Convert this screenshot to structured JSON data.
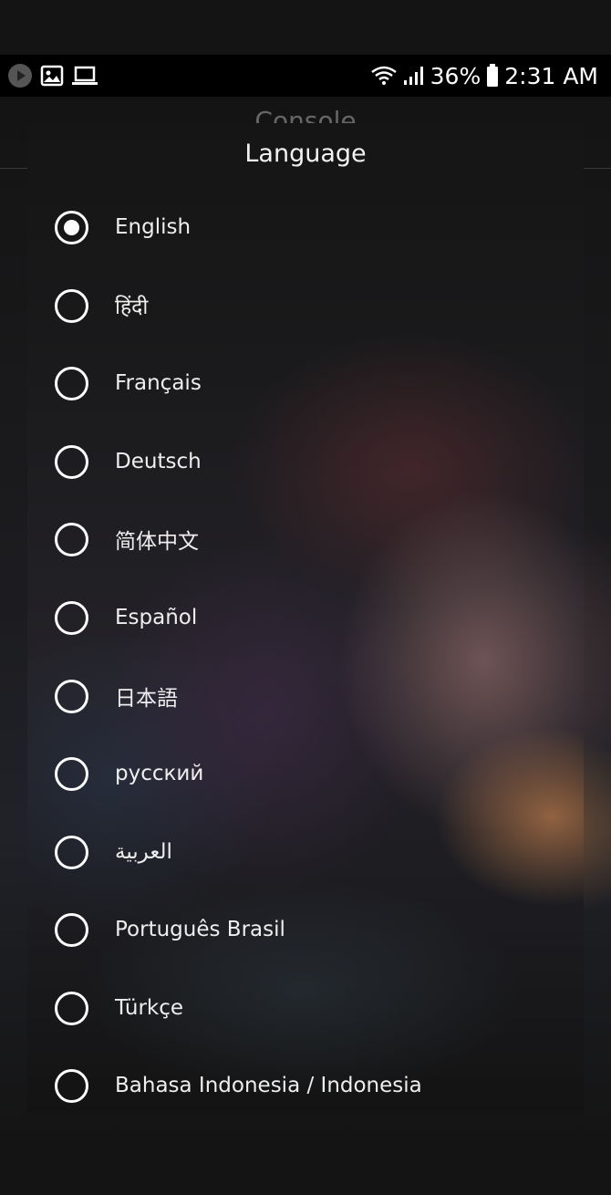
{
  "status_bar": {
    "battery": "36%",
    "time": "2:31 AM",
    "left_icons": [
      "play-icon",
      "image-icon",
      "laptop-icon"
    ],
    "right_icons": [
      "wifi-icon",
      "signal-icon",
      "battery-icon"
    ]
  },
  "background_screen": {
    "title": "Console"
  },
  "dialog": {
    "title": "Language",
    "options": [
      {
        "label": "English",
        "selected": true
      },
      {
        "label": "हिंदी",
        "selected": false
      },
      {
        "label": "Français",
        "selected": false
      },
      {
        "label": "Deutsch",
        "selected": false
      },
      {
        "label": "简体中文",
        "selected": false
      },
      {
        "label": "Español",
        "selected": false
      },
      {
        "label": "日本語",
        "selected": false
      },
      {
        "label": "русский",
        "selected": false
      },
      {
        "label": "العربية",
        "selected": false
      },
      {
        "label": "Português Brasil",
        "selected": false
      },
      {
        "label": "Türkçe",
        "selected": false
      },
      {
        "label": "Bahasa Indonesia / Indonesia",
        "selected": false
      }
    ]
  },
  "colors": {
    "radio": "#ffffff",
    "text": "#eeeeee",
    "status_bar_bg": "#000000"
  }
}
